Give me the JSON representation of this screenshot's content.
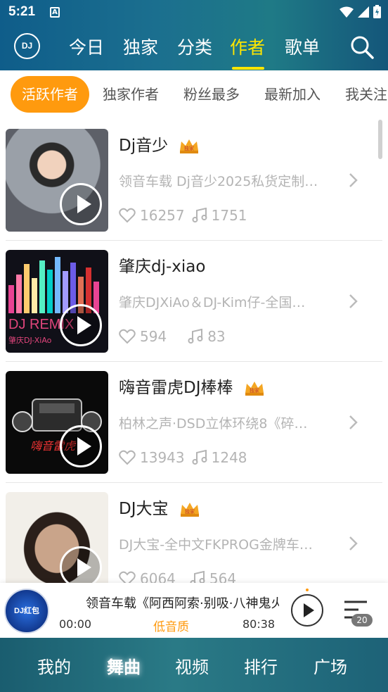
{
  "status": {
    "time": "5:21",
    "notif_letter": "A"
  },
  "header": {
    "logo": "DJ",
    "tabs": [
      "今日",
      "独家",
      "分类",
      "作者",
      "歌单"
    ],
    "active_tab": "作者"
  },
  "subtabs": [
    "活跃作者",
    "独家作者",
    "粉丝最多",
    "最新加入",
    "我关注"
  ],
  "authors": [
    {
      "name": "Dj音少",
      "desc": "领音车载 Dj音少2025私货定制…",
      "likes": "16257",
      "songs": "1751",
      "crown": true
    },
    {
      "name": "肇庆dj-xiao",
      "desc": "肇庆DJXiAo＆DJ-Kim仔-全国…",
      "likes": "594",
      "songs": "83",
      "crown": false,
      "thumb_text": "DJ REMIX",
      "thumb_sub": "肇庆DJ-XiAo"
    },
    {
      "name": "嗨音雷虎DJ棒棒",
      "desc": "柏林之声·DSD立体环绕8《碎…",
      "likes": "13943",
      "songs": "1248",
      "crown": true,
      "thumb_text": "嗨音雷虎"
    },
    {
      "name": "DJ大宝",
      "desc": "DJ大宝-全中文FKPROG金牌车…",
      "likes": "6064",
      "songs": "564",
      "crown": true
    }
  ],
  "crown_label": "独家",
  "player": {
    "disc_label": "DJ红包",
    "title": "领音车载《阿西阿索·别吸·八神鬼火》",
    "time_current": "00:00",
    "quality": "低音质",
    "time_total": "80:38",
    "queue_count": "20"
  },
  "bottom_nav": [
    "我的",
    "舞曲",
    "视频",
    "排行",
    "广场"
  ],
  "colors": {
    "accent": "#ff9a0e",
    "active_tab": "#ffe600",
    "header": "#1b6f8f"
  }
}
